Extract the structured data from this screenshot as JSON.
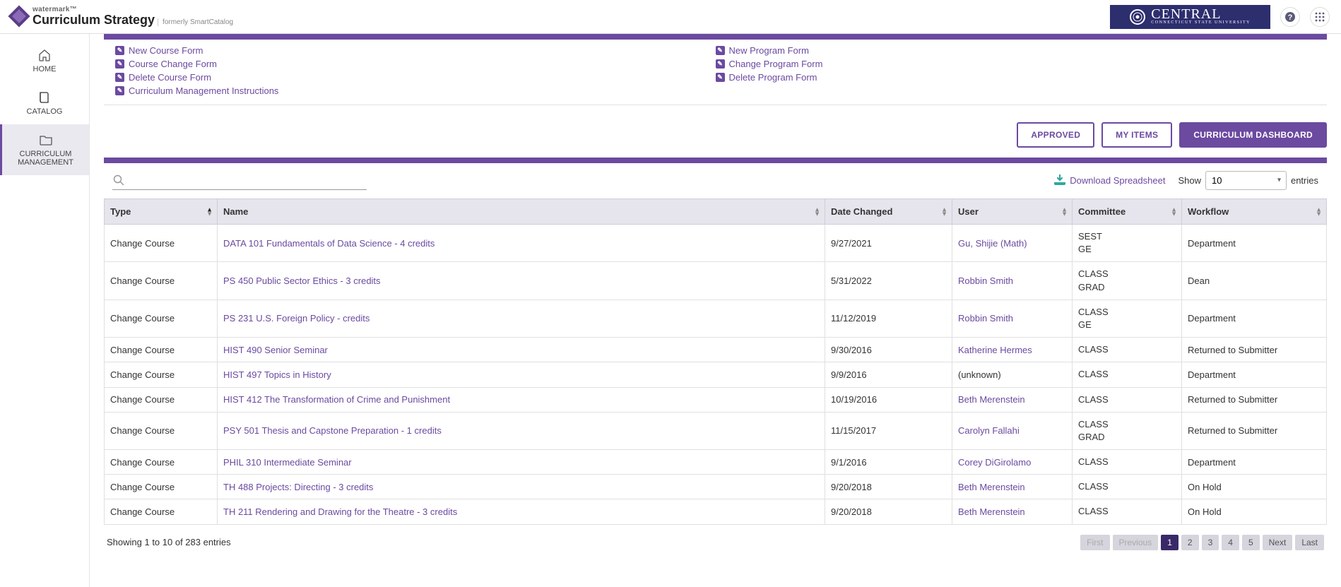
{
  "header": {
    "brand": "watermark™",
    "product": "Curriculum Strategy",
    "subtitle": "formerly SmartCatalog",
    "central_main": "CENTRAL",
    "central_sub": "CONNECTICUT STATE UNIVERSITY"
  },
  "sidebar": {
    "items": [
      {
        "label": "HOME",
        "icon": "home"
      },
      {
        "label": "CATALOG",
        "icon": "book"
      },
      {
        "label": "CURRICULUM MANAGEMENT",
        "icon": "folder",
        "active": true
      }
    ]
  },
  "form_links": {
    "left": [
      "New Course Form",
      "Course Change Form",
      "Delete Course Form",
      "Curriculum Management Instructions"
    ],
    "right": [
      "New Program Form",
      "Change Program Form",
      "Delete Program Form"
    ]
  },
  "buttons": {
    "approved": "APPROVED",
    "my_items": "MY ITEMS",
    "dashboard": "CURRICULUM DASHBOARD"
  },
  "controls": {
    "download": "Download Spreadsheet",
    "show_label": "Show",
    "show_value": "10",
    "entries_label": "entries",
    "search_placeholder": ""
  },
  "columns": [
    "Type",
    "Name",
    "Date Changed",
    "User",
    "Committee",
    "Workflow"
  ],
  "rows": [
    {
      "type": "Change Course",
      "name": "DATA 101 Fundamentals of Data Science - 4 credits",
      "date": "9/27/2021",
      "user": "Gu, Shijie (Math)",
      "committee": "SEST\nGE",
      "workflow": "Department"
    },
    {
      "type": "Change Course",
      "name": "PS 450 Public Sector Ethics - 3 credits",
      "date": "5/31/2022",
      "user": "Robbin Smith",
      "committee": "CLASS\nGRAD",
      "workflow": "Dean"
    },
    {
      "type": "Change Course",
      "name": "PS 231 U.S. Foreign Policy - credits",
      "date": "11/12/2019",
      "user": "Robbin Smith",
      "committee": "CLASS\nGE",
      "workflow": "Department"
    },
    {
      "type": "Change Course",
      "name": "HIST 490 Senior Seminar",
      "date": "9/30/2016",
      "user": "Katherine Hermes",
      "committee": "CLASS",
      "workflow": "Returned to Submitter"
    },
    {
      "type": "Change Course",
      "name": "HIST 497 Topics in History",
      "date": "9/9/2016",
      "user": "(unknown)",
      "committee": "CLASS",
      "workflow": "Department"
    },
    {
      "type": "Change Course",
      "name": "HIST 412 The Transformation of Crime and Punishment",
      "date": "10/19/2016",
      "user": "Beth Merenstein",
      "committee": "CLASS",
      "workflow": "Returned to Submitter"
    },
    {
      "type": "Change Course",
      "name": "PSY 501 Thesis and Capstone Preparation - 1 credits",
      "date": "11/15/2017",
      "user": "Carolyn Fallahi",
      "committee": "CLASS\nGRAD",
      "workflow": "Returned to Submitter"
    },
    {
      "type": "Change Course",
      "name": "PHIL 310 Intermediate Seminar",
      "date": "9/1/2016",
      "user": "Corey DiGirolamo",
      "committee": "CLASS",
      "workflow": "Department"
    },
    {
      "type": "Change Course",
      "name": "TH 488 Projects: Directing - 3 credits",
      "date": "9/20/2018",
      "user": "Beth Merenstein",
      "committee": "CLASS",
      "workflow": "On Hold"
    },
    {
      "type": "Change Course",
      "name": "TH 211 Rendering and Drawing for the Theatre - 3 credits",
      "date": "9/20/2018",
      "user": "Beth Merenstein",
      "committee": "CLASS",
      "workflow": "On Hold"
    }
  ],
  "footer": {
    "showing": "Showing 1 to 10 of 283 entries",
    "pager": {
      "first": "First",
      "prev": "Previous",
      "pages": [
        "1",
        "2",
        "3",
        "4",
        "5"
      ],
      "next": "Next",
      "last": "Last",
      "active": 0
    }
  }
}
